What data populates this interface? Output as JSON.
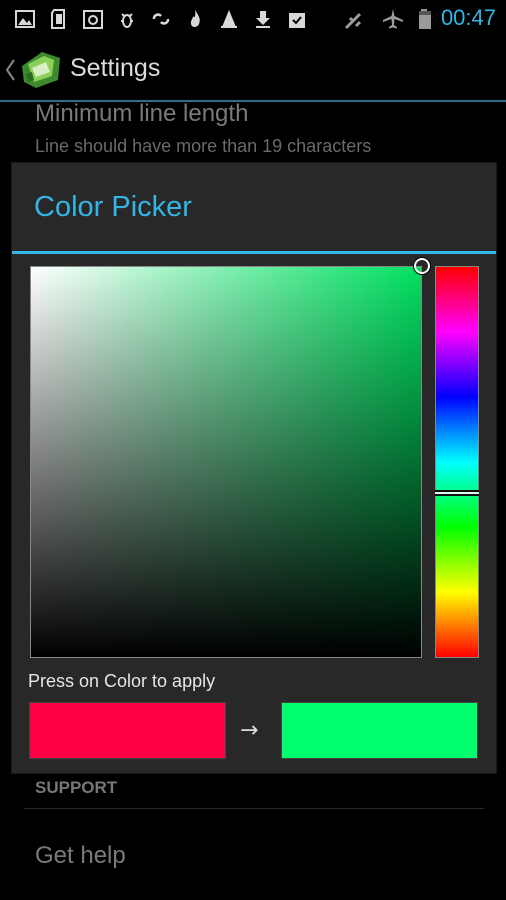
{
  "status_bar": {
    "time": "00:47",
    "icons": [
      "image-icon",
      "sd-card-icon",
      "sync-icon",
      "bug-icon",
      "link-icon",
      "flame-icon",
      "cone-icon",
      "download-icon",
      "clipboard-check-icon",
      "no-signal-icon",
      "airplane-icon",
      "battery-icon"
    ],
    "time_color": "#33b5e5"
  },
  "action_bar": {
    "title": "Settings",
    "logo": "app-logo-icon",
    "up": "chevron-left-icon"
  },
  "settings": {
    "pref_title": "Minimum line length",
    "pref_summary": "Line should have more than 19 characters",
    "section_header": "SUPPORT",
    "get_help": "Get help"
  },
  "dialog": {
    "title": "Color Picker",
    "accent": "#33b5e5",
    "apply_label": "Press on Color to apply",
    "arrow": "→",
    "picker": {
      "hue_color": "#00e060",
      "saturation": 1.0,
      "value": 1.0,
      "hue_position": 0.58
    },
    "old_color": "#ff0044",
    "new_color": "#00ff6e"
  }
}
